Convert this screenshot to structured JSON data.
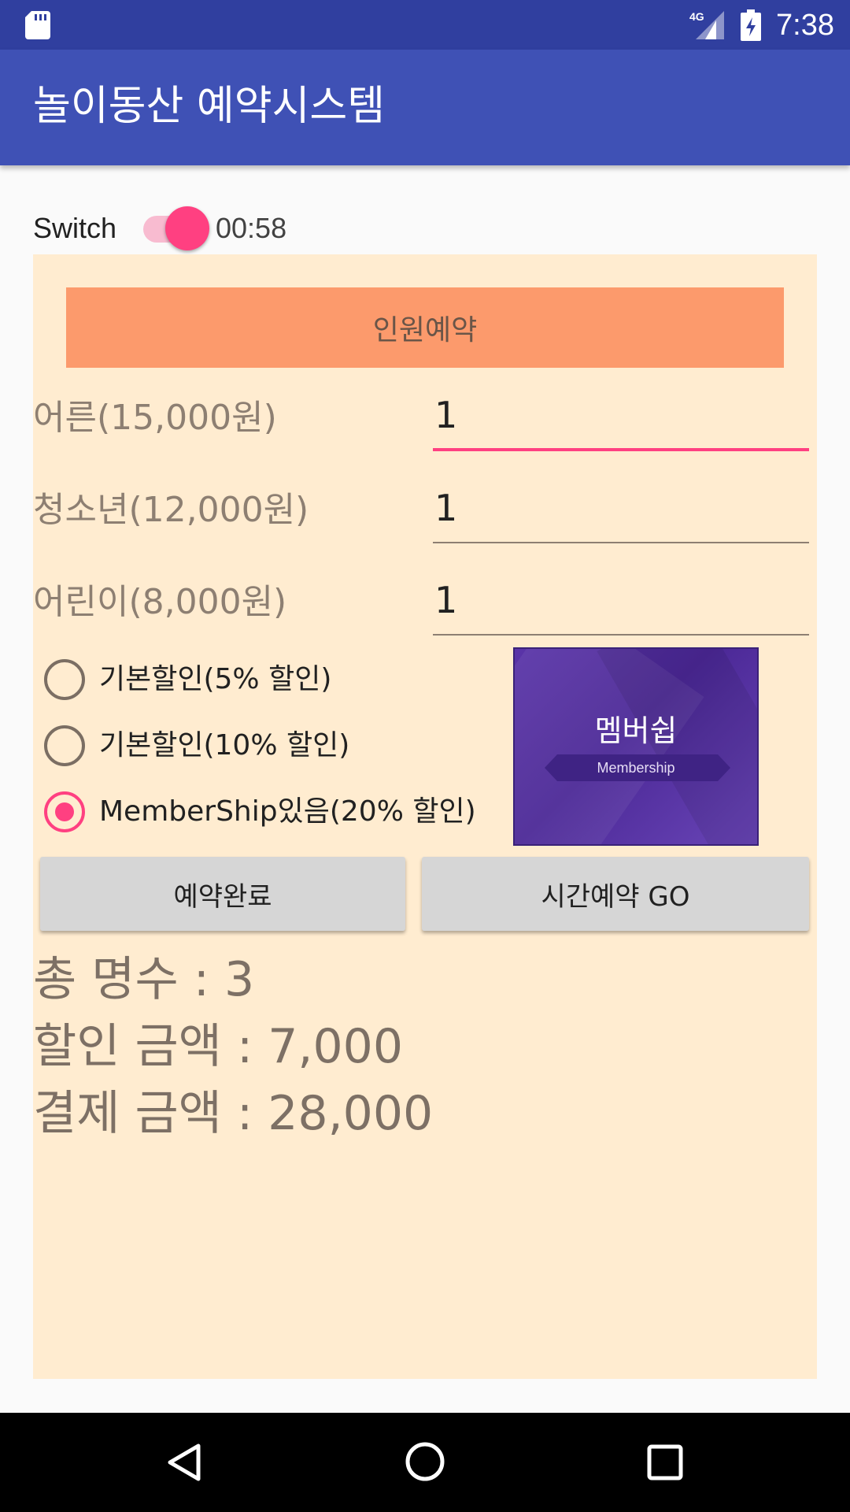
{
  "status_bar": {
    "network": "4G",
    "time": "7:38"
  },
  "app_bar": {
    "title": "놀이동산 예약시스템"
  },
  "switch": {
    "label": "Switch",
    "checked": true,
    "timer": "00:58"
  },
  "reservation": {
    "header": "인원예약",
    "fields": [
      {
        "label": "어른(15,000원)",
        "value": "1",
        "focused": true
      },
      {
        "label": "청소년(12,000원)",
        "value": "1",
        "focused": false
      },
      {
        "label": "어린이(8,000원)",
        "value": "1",
        "focused": false
      }
    ],
    "discounts": [
      {
        "label": "기본할인(5% 할인)",
        "checked": false
      },
      {
        "label": "기본할인(10% 할인)",
        "checked": false
      },
      {
        "label": "MemberShip있음(20% 할인)",
        "checked": true
      }
    ],
    "membership_image": {
      "title_ko": "멤버쉽",
      "title_en": "Membership"
    },
    "buttons": {
      "complete": "예약완료",
      "time_go": "시간예약 GO"
    },
    "summary": {
      "total_people": "총 명수 : 3",
      "discount_amount": "할인 금액 : 7,000",
      "payment_amount": "결제 금액 : 28,000"
    }
  },
  "colors": {
    "status_bar": "#303f9f",
    "app_bar": "#3f51b5",
    "accent": "#ff4081",
    "panel": "#ffecd0",
    "header": "#fc9a6c"
  },
  "icons": {
    "status": [
      "sd-card-icon",
      "signal-icon",
      "battery-charging-icon"
    ],
    "nav": [
      "back-icon",
      "home-icon",
      "recent-apps-icon"
    ]
  }
}
